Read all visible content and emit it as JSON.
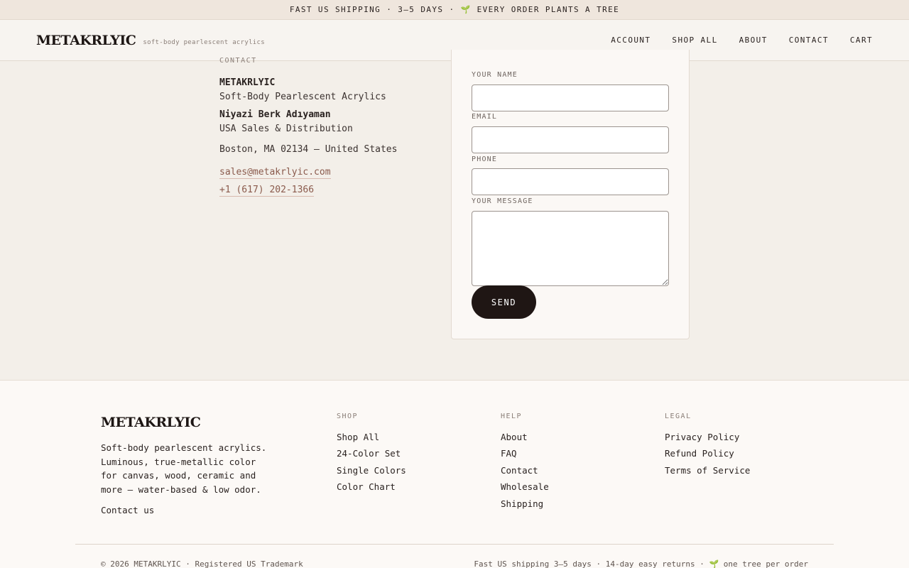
{
  "announcement": "FAST US SHIPPING · 3–5 DAYS · 🌱 EVERY ORDER PLANTS A TREE",
  "header": {
    "logo": "METAKRLYIC",
    "tagline": "soft-body pearlescent acrylics",
    "nav": [
      "ACCOUNT",
      "SHOP ALL",
      "ABOUT",
      "CONTACT",
      "CART"
    ]
  },
  "contact": {
    "eyebrow": "CONTACT",
    "brand": "METAKRLYIC",
    "brand_sub": "Soft-Body Pearlescent Acrylics",
    "person": "Niyazi Berk Adıyaman",
    "role": "USA Sales & Distribution",
    "address": "Boston, MA 02134 — United States",
    "email": "sales@metakrlyic.com",
    "phone": "+1 (617) 202-1366"
  },
  "form": {
    "name_label": "YOUR NAME",
    "email_label": "EMAIL",
    "phone_label": "PHONE",
    "message_label": "YOUR MESSAGE",
    "name_value": "",
    "email_value": "",
    "phone_value": "",
    "message_value": "",
    "send_label": "SEND"
  },
  "footer": {
    "logo": "METAKRLYIC",
    "description": "Soft-body pearlescent acrylics. Luminous, true-metallic color for canvas, wood, ceramic and more — water-based & low odor.",
    "contact_link": "Contact us",
    "columns": [
      {
        "heading": "SHOP",
        "links": [
          "Shop All",
          "24-Color Set",
          "Single Colors",
          "Color Chart"
        ]
      },
      {
        "heading": "HELP",
        "links": [
          "About",
          "FAQ",
          "Contact",
          "Wholesale",
          "Shipping"
        ]
      },
      {
        "heading": "LEGAL",
        "links": [
          "Privacy Policy",
          "Refund Policy",
          "Terms of Service"
        ]
      }
    ],
    "copyright": "© 2026 METAKRLYIC · Registered US Trademark",
    "perks": "Fast US shipping 3–5 days · 14-day easy returns · 🌱 one tree per order"
  },
  "colors": {
    "page_bg": "#f3efe9",
    "accent_link": "#8a5a4c",
    "button_bg": "#1f1614"
  }
}
